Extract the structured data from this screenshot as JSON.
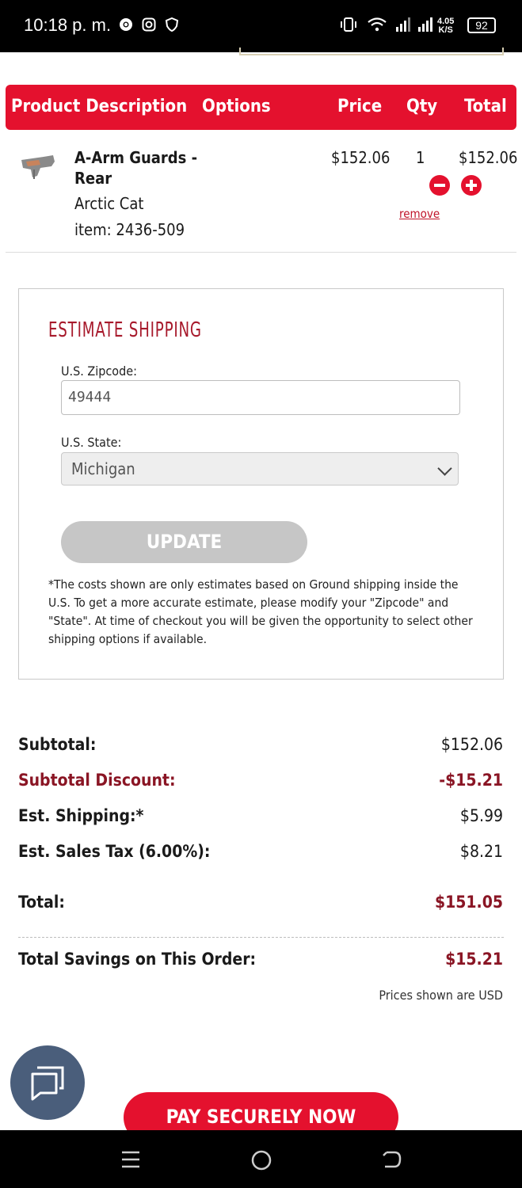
{
  "status_bar": {
    "time": "10:18 p. m.",
    "net_speed_top": "4.05",
    "net_speed_bottom": "K/S",
    "battery": "92"
  },
  "cart_header": {
    "col_product": "Product Description",
    "col_options": "Options",
    "col_price": "Price",
    "col_qty": "Qty",
    "col_total": "Total"
  },
  "cart_item": {
    "name": "A-Arm Guards - Rear",
    "brand": "Arctic Cat",
    "item_number": "item: 2436-509",
    "price": "$152.06",
    "qty": "1",
    "total": "$152.06",
    "remove_label": "remove"
  },
  "shipping": {
    "title": "ESTIMATE SHIPPING",
    "zip_label": "U.S. Zipcode:",
    "zip_value": "49444",
    "state_label": "U.S. State:",
    "state_value": "Michigan",
    "update_label": "UPDATE",
    "note": "*The costs shown are only estimates based on Ground shipping inside the U.S. To get a more accurate estimate, please modify your \"Zipcode\" and \"State\". At time of checkout you will be given the opportunity to select other shipping options if available."
  },
  "totals": {
    "subtotal_label": "Subtotal:",
    "subtotal_value": "$152.06",
    "discount_label": "Subtotal Discount:",
    "discount_value": "-$15.21",
    "shipping_label": "Est. Shipping:*",
    "shipping_value": "$5.99",
    "tax_label": "Est. Sales Tax (6.00%):",
    "tax_value": "$8.21",
    "total_label": "Total:",
    "total_value": "$151.05",
    "savings_label": "Total Savings on This Order:",
    "savings_value": "$15.21",
    "currency_note": "Prices shown are USD"
  },
  "pay_button": "PAY SECURELY NOW",
  "colors": {
    "brand_red": "#e4112e",
    "dark_red": "#8a1524",
    "chat_blue": "#4a5e7b"
  }
}
